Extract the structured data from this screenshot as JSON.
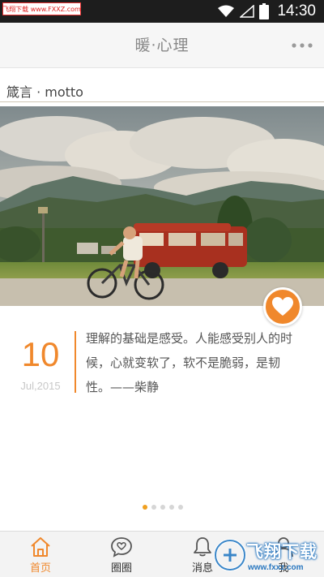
{
  "status_bar": {
    "watermark": "飞翔下载 www.FXXZ.com",
    "time": "14:30",
    "icons": [
      "wifi-icon",
      "cellular-signal-icon",
      "battery-icon"
    ]
  },
  "app_bar": {
    "title": "暖·心理",
    "more_icon": "more-dots-icon"
  },
  "section": {
    "label": "箴言 · motto"
  },
  "card": {
    "photo": "photo of a cyclist riding past a red van in a mountain valley",
    "like_icon": "heart-icon",
    "day": "10",
    "month_year": "Jul,2015",
    "quote": "理解的基础是感受。人能感受别人的时候，心就变软了，软不是脆弱，是韧性。——柴静"
  },
  "pager": {
    "count": 5,
    "active_index": 0
  },
  "bottom_nav": {
    "items": [
      {
        "label": "首页",
        "icon": "home-icon",
        "active": true
      },
      {
        "label": "圈圈",
        "icon": "chat-heart-icon",
        "active": false
      },
      {
        "label": "消息",
        "icon": "bell-icon",
        "active": false
      },
      {
        "label": "我",
        "icon": "user-icon",
        "active": false
      }
    ]
  },
  "watermark_bottom": {
    "text": "飞翔下载",
    "url": "www.fxxz.com"
  },
  "colors": {
    "accent": "#f0882c",
    "status_bar": "#1d1d1d",
    "app_bar": "#f6f6f6"
  }
}
